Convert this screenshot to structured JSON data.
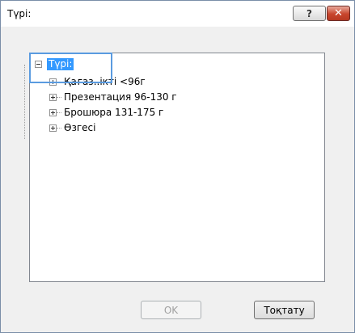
{
  "dialog": {
    "title": "Түрі:",
    "help_icon": "question-mark-icon",
    "close_icon": "close-x-icon"
  },
  "tree": {
    "root_label": "Түрі:",
    "items": [
      {
        "label": "Қағаз..ікті <96г"
      },
      {
        "label": "Презентация 96-130 г"
      },
      {
        "label": "Брошюра 131-175 г"
      },
      {
        "label": "Өзгесі"
      }
    ]
  },
  "buttons": {
    "ok_label": "OK",
    "cancel_label": "Тоқтату"
  }
}
